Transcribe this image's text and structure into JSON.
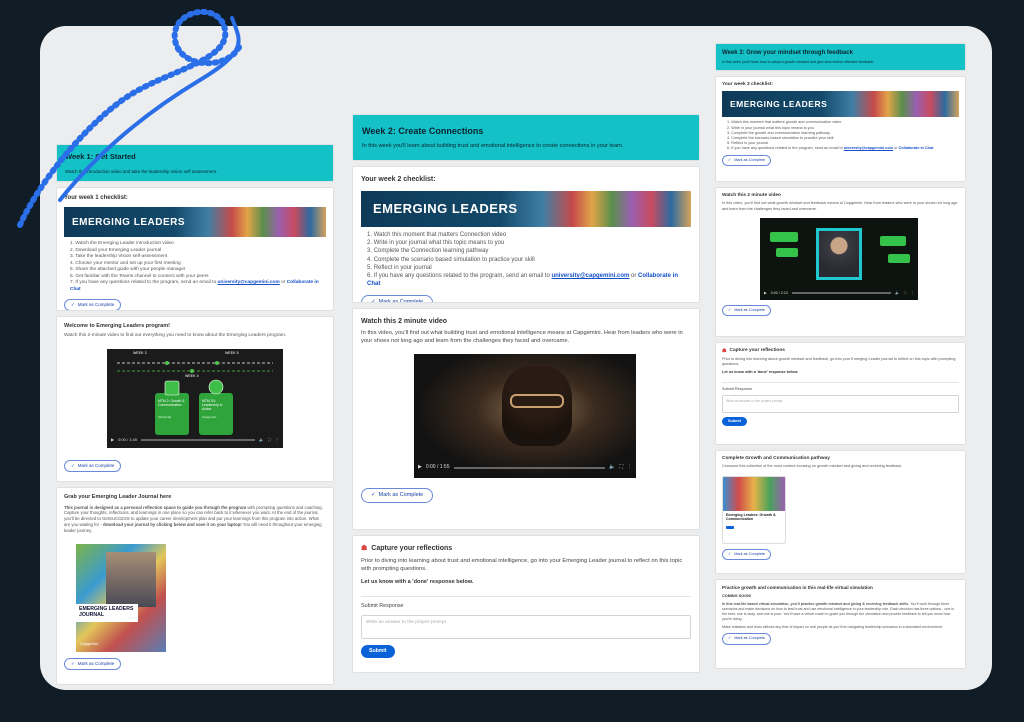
{
  "mark_complete": "Mark as Complete",
  "banner_text": "EMERGING LEADERS",
  "email": "university@capgemini.com",
  "or": " or ",
  "chat": "Collaborate in Chat",
  "submit": "Submit",
  "submit_response": "Submit Response",
  "placeholder": "Write an answer to the project prompt",
  "time": "0:00 / 1:55",
  "capture_title": "Capture your reflections",
  "capture_text": "Prior to diving into learning about trust and emotional intelligence, go into your Emerging Leader journal to reflect on this topic with prompting questions.",
  "done_text": "Let us know with a 'done' response below.",
  "week1": {
    "title": "Week 1: Get Started",
    "subtitle": "Watch the introduction video and take the leadership vision self assessment.",
    "checklist_title": "Your week 1 checklist:",
    "items": [
      "Watch the Emerging Leader introduction video",
      "Download your Emerging Leader journal",
      "Take the leadership Vision self-assessment",
      "Choose your mentor and set up your first meeting",
      "Share the attached guide with your people manager",
      "Get familiar with the Teams channel to connect with your peers",
      "If you have any questions related to the program, send an email to"
    ],
    "welcome_title": "Welcome to Emerging Leaders program!",
    "welcome_text": "Watch this 2-minute video to find out everything you need to know about the Emerging Leaders program.",
    "diagram": {
      "w3": "WEEK 3",
      "w4": "WEEK 4",
      "w5": "WEEK 5",
      "box1": "MTM 2: Growth & Communication",
      "box1_sub": "(Optional)",
      "box2": "MTM 3/1: Leadership in Action",
      "box2_sub": "Capgemini"
    },
    "video_time": "0:00 / 1:45",
    "journal_title": "Grab your Emerging Leader Journal here",
    "journal_bold": "This journal is designed as a personal reflection space to guide you through the program",
    "journal_text": " with prompting questions and coaching. Capture your thoughts, reflections, and learnings in one place so you can refer back to it whenever you want. At the end of the journal, you'll be directed to GetSUCCESS to update your career development plan and put your learnings from this program into action. What are you waiting for - ",
    "journal_bold2": "download your journal by clicking below and save it on your laptop!",
    "journal_text2": " You will need it throughout your emerging leader journey.",
    "cover_title": "EMERGING LEADERS JOURNAL",
    "cover_brand": "Capgemini"
  },
  "week2": {
    "title": "Week 2: Create Connections",
    "subtitle": "In this week you'll learn about building trust and emotional intelligence to create connections in your team.",
    "checklist_title": "Your week 2 checklist:",
    "items": [
      "Watch this moment that matters Connection video",
      "Write in your journal what this topic means to you",
      "Complete the Connection learning pathway",
      "Complete the scenario based simulation to practice your skill",
      "Reflect in your journal",
      "If you have any questions related to the program, send an email to"
    ],
    "video_title": "Watch this 2 minute video",
    "video_text": "In this video, you'll find out what building trust and emotional intelligence means at Capgemini. Hear from leaders who were in your shoes not long ago and learn from the challenges they faced and overcame."
  },
  "week3": {
    "title": "Week 3: Grow your mindset through feedback",
    "subtitle": "In this week you'll learn how to adopt a growth mindset and give and receive effective feedback.",
    "checklist_title": "Your week 3 checklist:",
    "items": [
      "Watch this moment that matters growth and communication video",
      "Write in your journal what this topic means to you",
      "Complete the growth and communication learning pathway",
      "Complete the scenario-based simulation to practice your skill",
      "Reflect in your journal",
      "If you have any questions related to the program, send an email to"
    ],
    "video_title": "Watch this 2 minute video",
    "video_text": "In this video, you'll find out what growth mindset and feedback means at Capgemini. Hear from leaders who were in your shoes not long ago and learn from the challenges they faced and overcame.",
    "video_time": "0:00 / 2:24",
    "capture_text": "Prior to diving into learning about growth mindset and feedback, go into your Emerging Leader journal to reflect on this topic with prompting questions.",
    "pathway_title": "Complete Growth and Communication pathway",
    "pathway_text": "Consume this collection of the most content focusing on growth mindset and giving and receiving feedback.",
    "pathway_card": "Emerging Leaders: Growth & Communication",
    "sim_title": "Practice growth and communication in this real-life virtual simulation",
    "sim_soon": "COMING SOON!",
    "sim_bold": "In this real-life based virtual simulation, you'll practice growth mindset and giving & receiving feedback skills.",
    "sim_text": " You'll work through three scenarios and make decisions on how to lead trust and use emotional intelligence in your leadership role. Each decision has three options - one is the best, one is okay, and one is poor. You'll have a virtual coach to guide you through the simulation and provide feedback to tell you know how you're doing.",
    "sim_text2": "Make mistakes and learn without any fear of impact on real people as you'll be navigating leadership scenarios in a simulated environment."
  }
}
